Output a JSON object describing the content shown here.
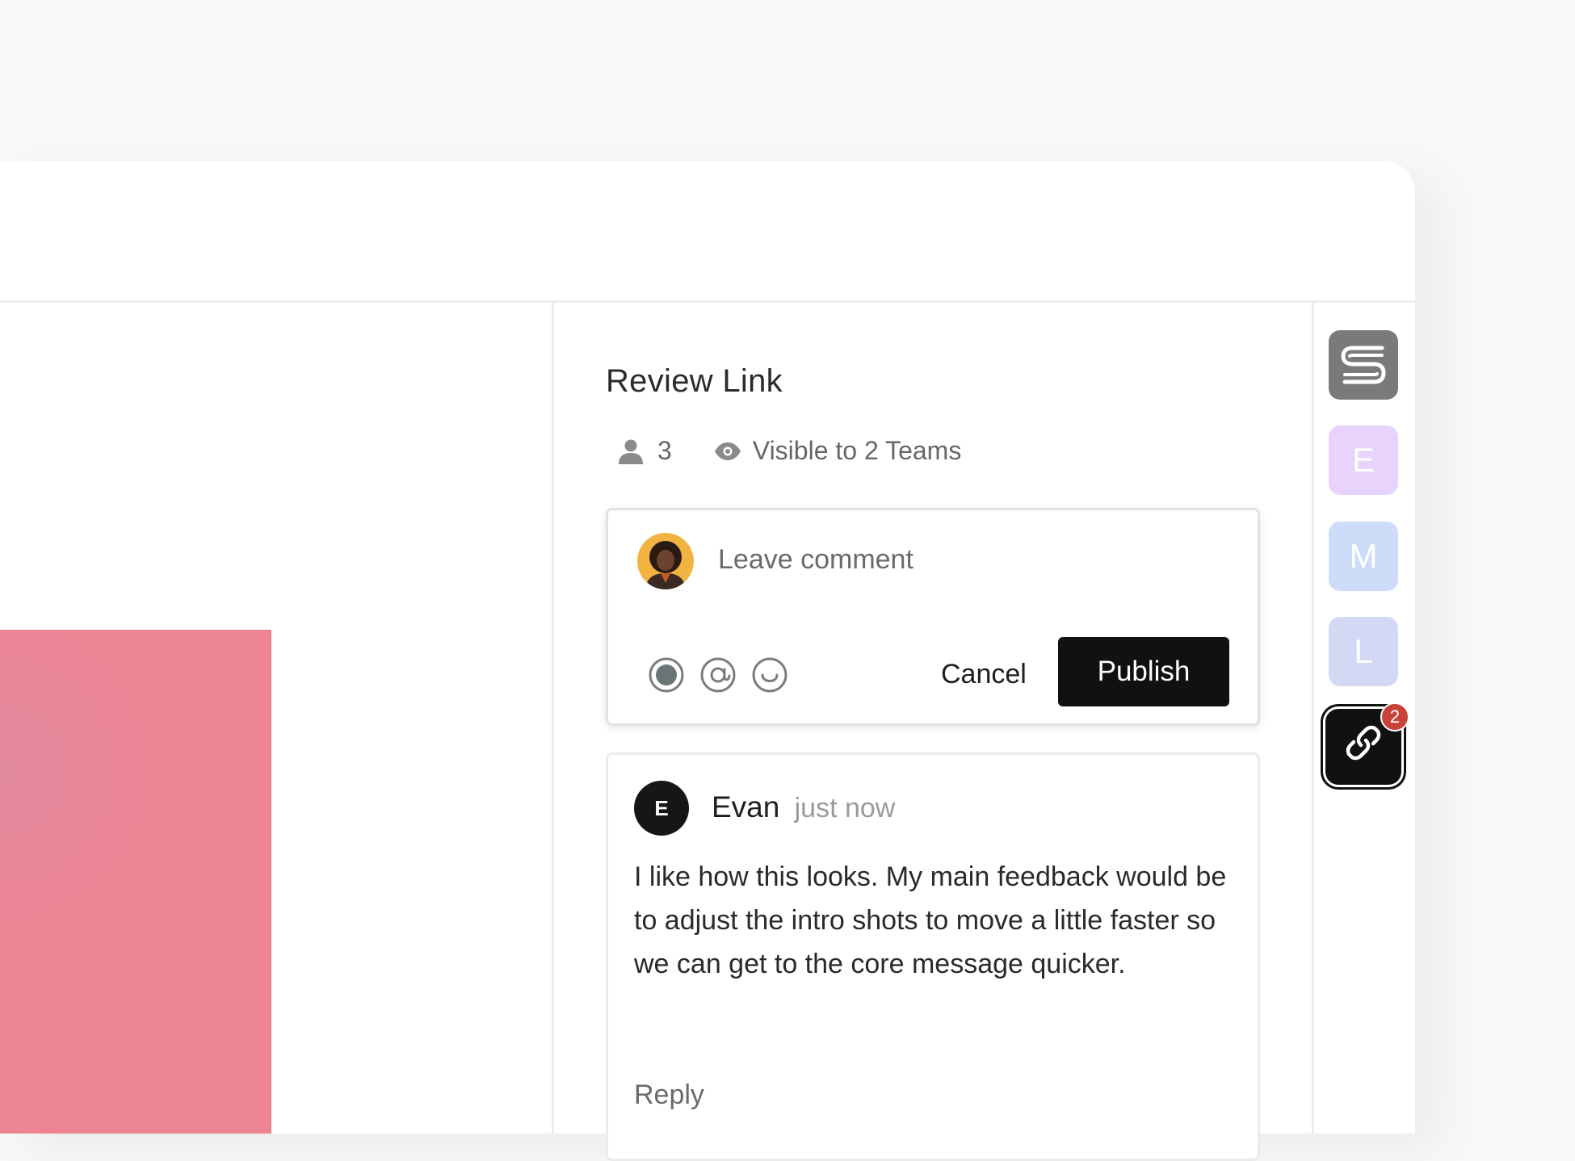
{
  "panel": {
    "title": "Review Link",
    "member_count": "3",
    "visibility": "Visible to 2 Teams"
  },
  "composer": {
    "placeholder": "Leave comment",
    "cancel_label": "Cancel",
    "publish_label": "Publish",
    "tools": [
      "record-icon",
      "mention-icon",
      "emoji-icon"
    ]
  },
  "comment": {
    "avatar_initial": "E",
    "author": "Evan",
    "time": "just now",
    "body": "I like how this looks. My main feedback would be to adjust the intro shots to move a little faster so we can get to the core message quicker.",
    "reply_label": "Reply"
  },
  "rail": {
    "users": [
      {
        "initial": "E",
        "color": "#e7d3fb"
      },
      {
        "initial": "M",
        "color": "#cddcf8"
      },
      {
        "initial": "L",
        "color": "#d3d9f5"
      }
    ],
    "link_badge": "2"
  },
  "colors": {
    "accent_dark": "#111111",
    "badge": "#c9423a",
    "preview_pink": "#ec8491"
  }
}
